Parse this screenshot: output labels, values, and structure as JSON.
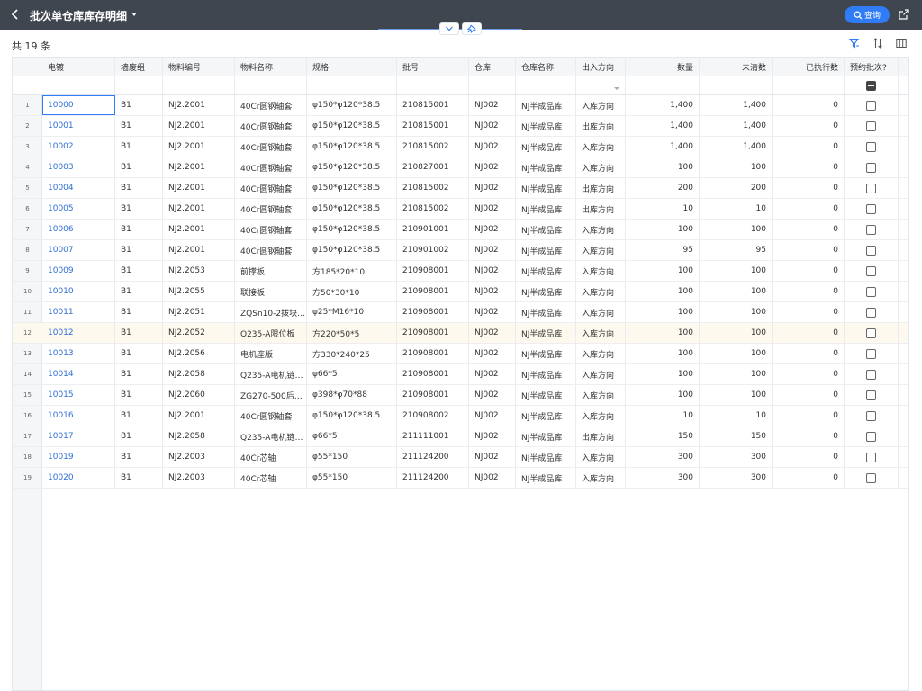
{
  "header": {
    "title": "批次单仓库库存明细",
    "query_label": "查询"
  },
  "toolbar": {
    "count_label": "共 19 条"
  },
  "columns": [
    "电镀",
    "墙废组",
    "物料编号",
    "物料名称",
    "规格",
    "批号",
    "仓库",
    "仓库名称",
    "出入方向",
    "数量",
    "未清数",
    "已执行数",
    "预约批次?"
  ],
  "rows": [
    {
      "num": "1",
      "code": "10000",
      "grp": "B1",
      "mat": "NJ2.2001",
      "name": "40Cr圆钢轴套",
      "spec": "φ150*φ120*38.5",
      "batch": "210815001",
      "wh": "NJ002",
      "whname": "NJ半成品库",
      "dir": "入库方向",
      "qty": "1,400",
      "open": "1,400",
      "done": "0"
    },
    {
      "num": "2",
      "code": "10001",
      "grp": "B1",
      "mat": "NJ2.2001",
      "name": "40Cr圆钢轴套",
      "spec": "φ150*φ120*38.5",
      "batch": "210815001",
      "wh": "NJ002",
      "whname": "NJ半成品库",
      "dir": "出库方向",
      "qty": "1,400",
      "open": "1,400",
      "done": "0"
    },
    {
      "num": "3",
      "code": "10002",
      "grp": "B1",
      "mat": "NJ2.2001",
      "name": "40Cr圆钢轴套",
      "spec": "φ150*φ120*38.5",
      "batch": "210815002",
      "wh": "NJ002",
      "whname": "NJ半成品库",
      "dir": "入库方向",
      "qty": "1,400",
      "open": "1,400",
      "done": "0"
    },
    {
      "num": "4",
      "code": "10003",
      "grp": "B1",
      "mat": "NJ2.2001",
      "name": "40Cr圆钢轴套",
      "spec": "φ150*φ120*38.5",
      "batch": "210827001",
      "wh": "NJ002",
      "whname": "NJ半成品库",
      "dir": "入库方向",
      "qty": "100",
      "open": "100",
      "done": "0"
    },
    {
      "num": "5",
      "code": "10004",
      "grp": "B1",
      "mat": "NJ2.2001",
      "name": "40Cr圆钢轴套",
      "spec": "φ150*φ120*38.5",
      "batch": "210815002",
      "wh": "NJ002",
      "whname": "NJ半成品库",
      "dir": "出库方向",
      "qty": "200",
      "open": "200",
      "done": "0"
    },
    {
      "num": "6",
      "code": "10005",
      "grp": "B1",
      "mat": "NJ2.2001",
      "name": "40Cr圆钢轴套",
      "spec": "φ150*φ120*38.5",
      "batch": "210815002",
      "wh": "NJ002",
      "whname": "NJ半成品库",
      "dir": "出库方向",
      "qty": "10",
      "open": "10",
      "done": "0"
    },
    {
      "num": "7",
      "code": "10006",
      "grp": "B1",
      "mat": "NJ2.2001",
      "name": "40Cr圆钢轴套",
      "spec": "φ150*φ120*38.5",
      "batch": "210901001",
      "wh": "NJ002",
      "whname": "NJ半成品库",
      "dir": "入库方向",
      "qty": "100",
      "open": "100",
      "done": "0"
    },
    {
      "num": "8",
      "code": "10007",
      "grp": "B1",
      "mat": "NJ2.2001",
      "name": "40Cr圆钢轴套",
      "spec": "φ150*φ120*38.5",
      "batch": "210901002",
      "wh": "NJ002",
      "whname": "NJ半成品库",
      "dir": "入库方向",
      "qty": "95",
      "open": "95",
      "done": "0"
    },
    {
      "num": "9",
      "code": "10009",
      "grp": "B1",
      "mat": "NJ2.2053",
      "name": "前撑板",
      "spec": "方185*20*10",
      "batch": "210908001",
      "wh": "NJ002",
      "whname": "NJ半成品库",
      "dir": "入库方向",
      "qty": "100",
      "open": "100",
      "done": "0"
    },
    {
      "num": "10",
      "code": "10010",
      "grp": "B1",
      "mat": "NJ2.2055",
      "name": "联接板",
      "spec": "方50*30*10",
      "batch": "210908001",
      "wh": "NJ002",
      "whname": "NJ半成品库",
      "dir": "入库方向",
      "qty": "100",
      "open": "100",
      "done": "0"
    },
    {
      "num": "11",
      "code": "10011",
      "grp": "B1",
      "mat": "NJ2.2051",
      "name": "ZQSn10-2拨块…",
      "spec": "φ25*M16*10",
      "batch": "210908001",
      "wh": "NJ002",
      "whname": "NJ半成品库",
      "dir": "入库方向",
      "qty": "100",
      "open": "100",
      "done": "0"
    },
    {
      "num": "12",
      "code": "10012",
      "grp": "B1",
      "mat": "NJ2.2052",
      "name": "Q235-A限位板",
      "spec": "方220*50*5",
      "batch": "210908001",
      "wh": "NJ002",
      "whname": "NJ半成品库",
      "dir": "入库方向",
      "qty": "100",
      "open": "100",
      "done": "0"
    },
    {
      "num": "13",
      "code": "10013",
      "grp": "B1",
      "mat": "NJ2.2056",
      "name": "电机座版",
      "spec": "方330*240*25",
      "batch": "210908001",
      "wh": "NJ002",
      "whname": "NJ半成品库",
      "dir": "入库方向",
      "qty": "100",
      "open": "100",
      "done": "0"
    },
    {
      "num": "14",
      "code": "10014",
      "grp": "B1",
      "mat": "NJ2.2058",
      "name": "Q235-A电机链…",
      "spec": "φ66*5",
      "batch": "210908001",
      "wh": "NJ002",
      "whname": "NJ半成品库",
      "dir": "入库方向",
      "qty": "100",
      "open": "100",
      "done": "0"
    },
    {
      "num": "15",
      "code": "10015",
      "grp": "B1",
      "mat": "NJ2.2060",
      "name": "ZG270-500后…",
      "spec": "φ398*φ70*88",
      "batch": "210908001",
      "wh": "NJ002",
      "whname": "NJ半成品库",
      "dir": "入库方向",
      "qty": "100",
      "open": "100",
      "done": "0"
    },
    {
      "num": "16",
      "code": "10016",
      "grp": "B1",
      "mat": "NJ2.2001",
      "name": "40Cr圆钢轴套",
      "spec": "φ150*φ120*38.5",
      "batch": "210908002",
      "wh": "NJ002",
      "whname": "NJ半成品库",
      "dir": "入库方向",
      "qty": "10",
      "open": "10",
      "done": "0"
    },
    {
      "num": "17",
      "code": "10017",
      "grp": "B1",
      "mat": "NJ2.2058",
      "name": "Q235-A电机链…",
      "spec": "φ66*5",
      "batch": "211111001",
      "wh": "NJ002",
      "whname": "NJ半成品库",
      "dir": "出库方向",
      "qty": "150",
      "open": "150",
      "done": "0"
    },
    {
      "num": "18",
      "code": "10019",
      "grp": "B1",
      "mat": "NJ2.2003",
      "name": "40Cr芯轴",
      "spec": "φ55*150",
      "batch": "211124200",
      "wh": "NJ002",
      "whname": "NJ半成品库",
      "dir": "入库方向",
      "qty": "300",
      "open": "300",
      "done": "0"
    },
    {
      "num": "19",
      "code": "10020",
      "grp": "B1",
      "mat": "NJ2.2003",
      "name": "40Cr芯轴",
      "spec": "φ55*150",
      "batch": "211124200",
      "wh": "NJ002",
      "whname": "NJ半成品库",
      "dir": "入库方向",
      "qty": "300",
      "open": "300",
      "done": "0"
    }
  ],
  "icons": {
    "back": "chevron-left-icon",
    "caret": "caret-down-icon",
    "search": "search-icon",
    "export": "export-icon",
    "filter": "filter-icon",
    "sort": "sort-icon",
    "columns": "columns-icon",
    "collapse": "chevron-down-icon",
    "pin": "pin-icon"
  },
  "colors": {
    "topbar": "#3f4650",
    "accent": "#2f7cf6",
    "link": "#2f6fd6",
    "highlight_row": "#fdf9ee"
  }
}
